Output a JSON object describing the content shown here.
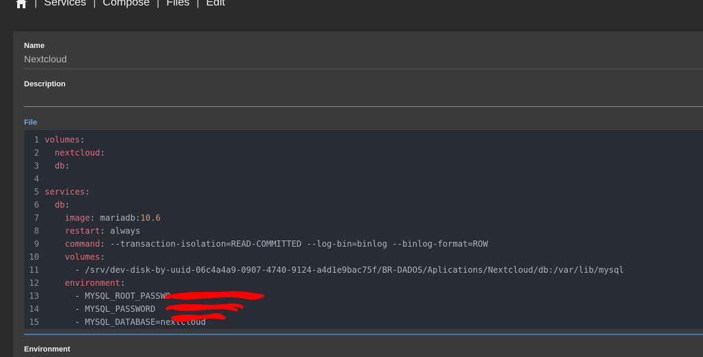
{
  "nav": {
    "items": [
      "Services",
      "Compose",
      "Files",
      "Edit"
    ]
  },
  "form": {
    "name_label": "Name",
    "name_value": "Nextcloud",
    "description_label": "Description",
    "description_value": "",
    "file_label": "File",
    "environment_label": "Environment"
  },
  "editor": {
    "lines": [
      {
        "n": "1",
        "text": "volumes:"
      },
      {
        "n": "2",
        "text": "  nextcloud:"
      },
      {
        "n": "3",
        "text": "  db:"
      },
      {
        "n": "4",
        "text": ""
      },
      {
        "n": "5",
        "text": "services:"
      },
      {
        "n": "6",
        "text": "  db:"
      },
      {
        "n": "7",
        "text": "    image: mariadb:10.6"
      },
      {
        "n": "8",
        "text": "    restart: always"
      },
      {
        "n": "9",
        "text": "    command: --transaction-isolation=READ-COMMITTED --log-bin=binlog --binlog-format=ROW"
      },
      {
        "n": "10",
        "text": "    volumes:"
      },
      {
        "n": "11",
        "text": "      - /srv/dev-disk-by-uuid-06c4a4a9-0907-4740-9124-a4d1e9bac75f/BR-DADOS/Aplications/Nextcloud/db:/var/lib/mysql"
      },
      {
        "n": "12",
        "text": "    environment:"
      },
      {
        "n": "13",
        "text": "      - MYSQL_ROOT_PASSWO"
      },
      {
        "n": "14",
        "text": "      - MYSQL_PASSWORD"
      },
      {
        "n": "15",
        "text": "      - MYSQL_DATABASE=nextcloud"
      }
    ]
  },
  "colors": {
    "background": "#2b2b2b",
    "card": "#3a3a3a",
    "editor": "#282c34",
    "accent": "#3d7ab5",
    "key": "#e06c75",
    "number": "#d19a66",
    "redaction": "#ff0000"
  }
}
